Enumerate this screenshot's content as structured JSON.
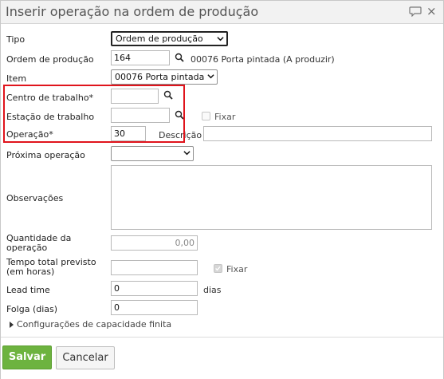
{
  "dialog": {
    "title": "Inserir operação na ordem de produção",
    "close_symbol": "×",
    "icons": {
      "chat": "chat-bubble-icon",
      "close": "close-icon",
      "search": "search-icon",
      "dropdown": "chevron-down-icon"
    }
  },
  "form": {
    "tipo": {
      "label": "Tipo",
      "value": "Ordem de produção"
    },
    "ordem": {
      "label": "Ordem de produção",
      "value": "164",
      "info": "00076 Porta pintada (A produzir)"
    },
    "item": {
      "label": "Item",
      "value": "00076 Porta pintada"
    },
    "centro": {
      "label": "Centro de trabalho*",
      "value": ""
    },
    "estacao": {
      "label": "Estação de trabalho",
      "value": "",
      "fixar_label": "Fixar",
      "fixar_checked": false
    },
    "operacao": {
      "label": "Operação*",
      "value": "30",
      "descricao_label": "Descrição",
      "descricao_value": ""
    },
    "proxima": {
      "label": "Próxima operação",
      "value": ""
    },
    "observacoes": {
      "label": "Observações",
      "value": ""
    },
    "quantidade": {
      "label_line1": "Quantidade da",
      "label_line2": "operação",
      "value": "0,00"
    },
    "tempo": {
      "label_line1": "Tempo total previsto",
      "label_line2": "(em horas)",
      "value": "",
      "fixar_label": "Fixar",
      "fixar_checked": true
    },
    "lead": {
      "label": "Lead time",
      "value": "0",
      "unit": "dias"
    },
    "folga": {
      "label": "Folga (dias)",
      "value": "0"
    },
    "capacidade": {
      "label": "Configurações de capacidade finita"
    }
  },
  "actions": {
    "save_label": "Salvar",
    "cancel_label": "Cancelar"
  },
  "colors": {
    "highlight": "#e0141c",
    "save_bg": "#6db33f"
  }
}
